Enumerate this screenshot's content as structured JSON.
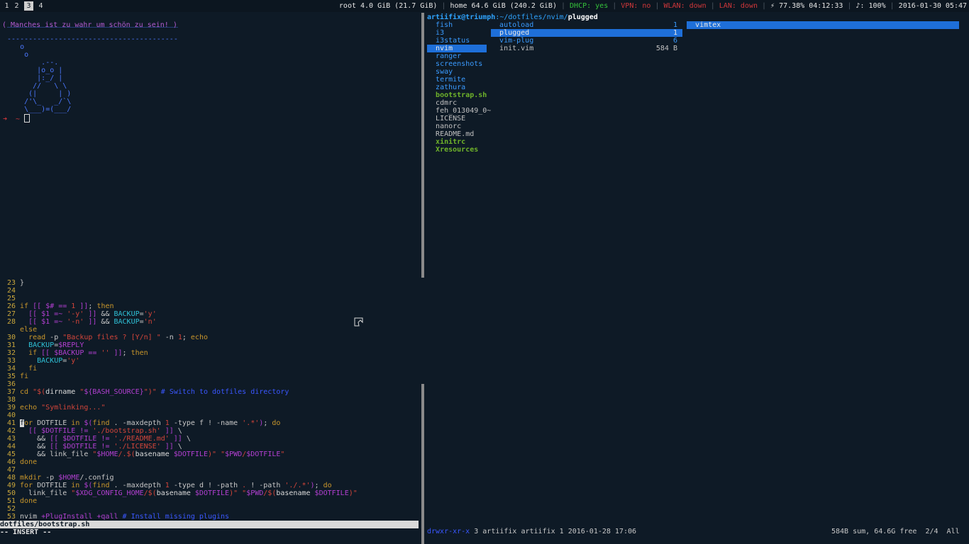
{
  "workspaces": [
    {
      "num": "1",
      "active": false
    },
    {
      "num": "2",
      "active": false
    },
    {
      "num": "3",
      "active": true
    },
    {
      "num": "4",
      "active": false
    }
  ],
  "status": {
    "root": "root 4.0 GiB (21.7 GiB)",
    "home": "home 64.6 GiB (240.2 GiB)",
    "dhcp": "DHCP: yes",
    "vpn": "VPN: no",
    "wlan": "WLAN: down",
    "lan": "LAN: down",
    "battery": "⚡ 77.38% 04:12:33",
    "volume": "♪: 100%",
    "datetime": "2016-01-30 05:47"
  },
  "terminal": {
    "quote": "( Manches ist zu wahr um schön zu sein! )",
    "cow": " ________________________________________\n\n ----------------------------------------\n    o\n     o\n         .--.\n        |o_o |\n        |:_/ |\n       //   \\ \\\n      (|     | )\n     /'\\_   _/`\\\n     \\___)=(___/",
    "prompt": "➜  ~ "
  },
  "editor": {
    "statusline": "dotfiles/bootstrap.sh",
    "mode": "-- INSERT --"
  },
  "ranger": {
    "host": "artiifix@triumph",
    "path": ":~/dotfiles/nvim/",
    "current": "plugged",
    "col1": [
      "fish",
      "i3",
      "i3status",
      "nvim",
      "ranger",
      "screenshots",
      "sway",
      "termite",
      "zathura",
      "bootstrap.sh",
      "cdmrc",
      "feh_013049_0~",
      "LICENSE",
      "nanorc",
      "README.md",
      "xinitrc",
      "Xresources"
    ],
    "col2": [
      {
        "name": "autoload",
        "count": "1"
      },
      {
        "name": "plugged",
        "count": "1"
      },
      {
        "name": "vim-plug",
        "count": "6"
      },
      {
        "name": "init.vim",
        "count": "584 B"
      }
    ],
    "col3": [
      "vimtex"
    ],
    "footer_perm": "drwxr-xr-x",
    "footer_info": " 3 artiifix artiifix 1 2016-01-28 17:06",
    "footer_right": "584B sum, 64.6G free  2/4  All"
  }
}
